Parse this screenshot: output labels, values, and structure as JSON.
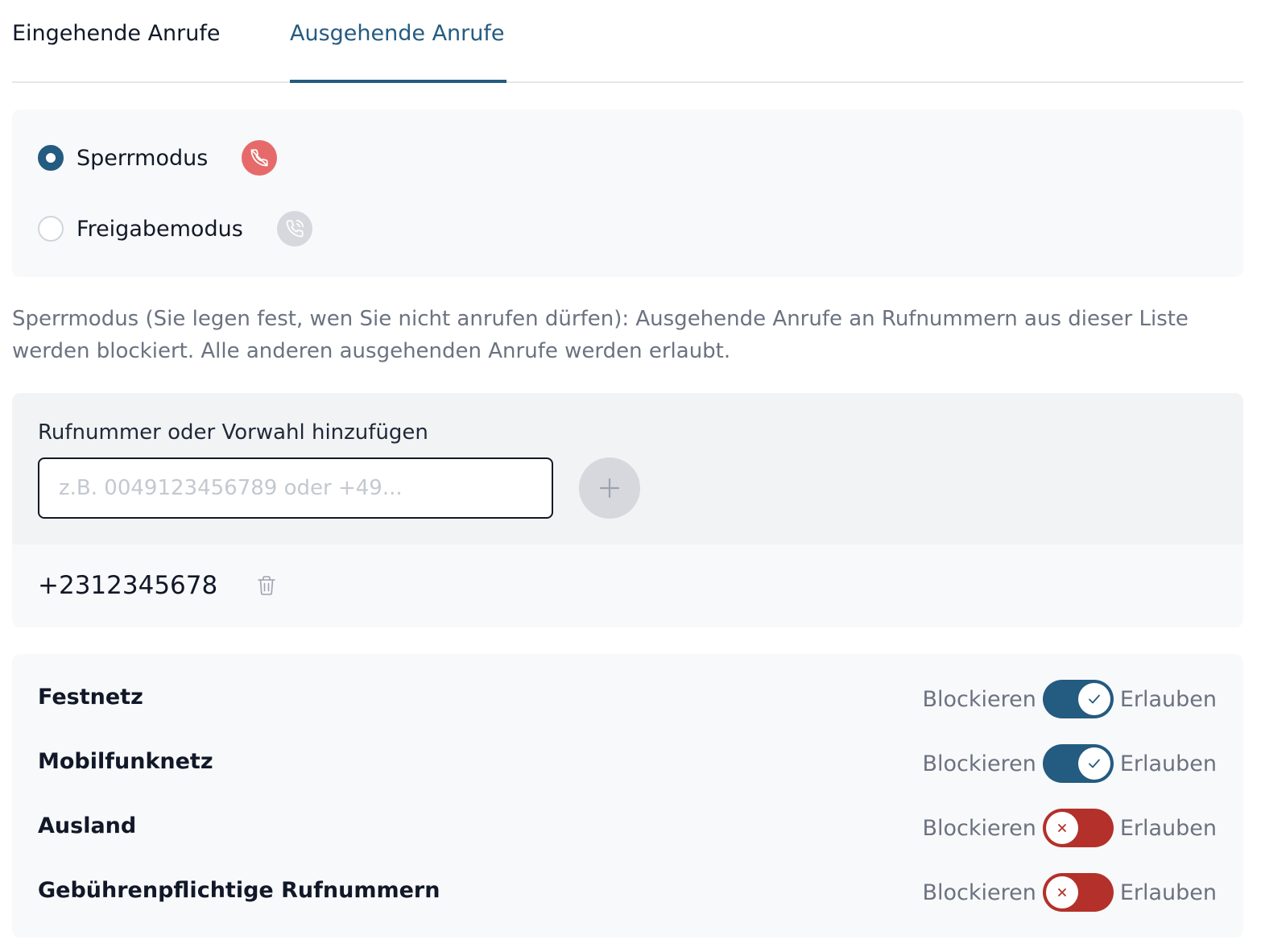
{
  "tabs": [
    {
      "label": "Eingehende Anrufe",
      "active": false
    },
    {
      "label": "Ausgehende Anrufe",
      "active": true
    }
  ],
  "modes": [
    {
      "label": "Sperrmodus",
      "selected": true,
      "icon": "phone-blocked-icon",
      "icon_color": "#e76a6a"
    },
    {
      "label": "Freigabemodus",
      "selected": false,
      "icon": "phone-allowed-icon",
      "icon_color": "#d6d8dd"
    }
  ],
  "description": "Sperrmodus (Sie legen fest, wen Sie nicht anrufen dürfen): Ausgehende Anrufe an Rufnummern aus dieser Liste werden blockiert. Alle anderen ausgehenden Anrufe werden erlaubt.",
  "add_number": {
    "label": "Rufnummer oder Vorwahl hinzufügen",
    "value": "",
    "placeholder": "z.B. 0049123456789 oder +49...",
    "button_icon": "plus-icon"
  },
  "numbers": [
    {
      "value": "+2312345678",
      "delete_icon": "trash-icon"
    }
  ],
  "categories": [
    {
      "name": "Festnetz",
      "block_label": "Blockieren",
      "allow_label": "Erlauben",
      "allowed": true
    },
    {
      "name": "Mobilfunknetz",
      "block_label": "Blockieren",
      "allow_label": "Erlauben",
      "allowed": true
    },
    {
      "name": "Ausland",
      "block_label": "Blockieren",
      "allow_label": "Erlauben",
      "allowed": false
    },
    {
      "name": "Gebührenpflichtige Rufnummern",
      "block_label": "Blockieren",
      "allow_label": "Erlauben",
      "allowed": false
    }
  ],
  "colors": {
    "accent": "#245b80",
    "blocked": "#b3312a",
    "muted_text": "#6b7280"
  }
}
